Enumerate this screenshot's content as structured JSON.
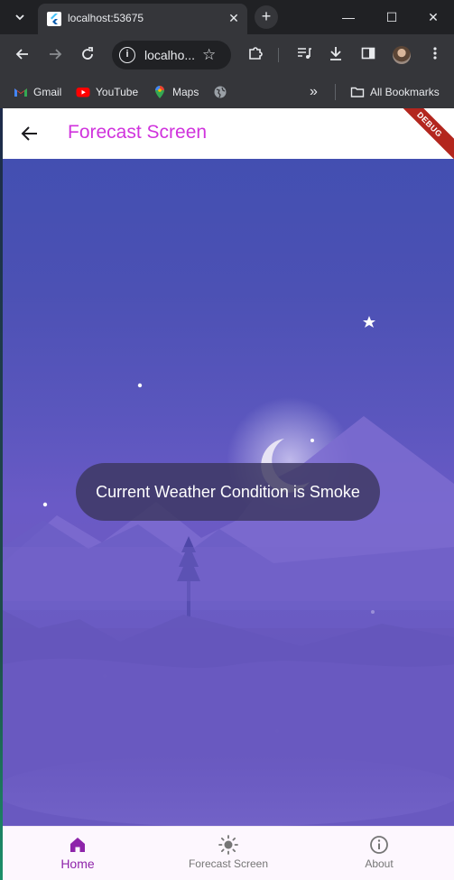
{
  "browser": {
    "tab_title": "localhost:53675",
    "tab_close": "✕",
    "new_tab": "+",
    "window_controls": {
      "minimize": "—",
      "maximize": "☐",
      "close": "✕"
    },
    "address": "localho...",
    "info_glyph": "i",
    "bookmarks": [
      {
        "label": "Gmail",
        "icon": "gmail-icon"
      },
      {
        "label": "YouTube",
        "icon": "youtube-icon"
      },
      {
        "label": "Maps",
        "icon": "maps-icon"
      },
      {
        "label": "",
        "icon": "globe-icon"
      }
    ],
    "overflow": "»",
    "all_bookmarks": "All Bookmarks"
  },
  "app": {
    "title": "Forecast Screen",
    "debug_banner": "DEBUG",
    "toast": "Current Weather Condition is Smoke",
    "nav": [
      {
        "label": "Home",
        "icon": "home-icon",
        "active": true
      },
      {
        "label": "Forecast Screen",
        "icon": "sun-icon",
        "active": false
      },
      {
        "label": "About",
        "icon": "info-icon",
        "active": false
      }
    ]
  },
  "colors": {
    "title": "#d033dd",
    "active_nav": "#8e24aa",
    "scene_top": "#434fb1",
    "scene_bottom": "#6a58c0"
  }
}
